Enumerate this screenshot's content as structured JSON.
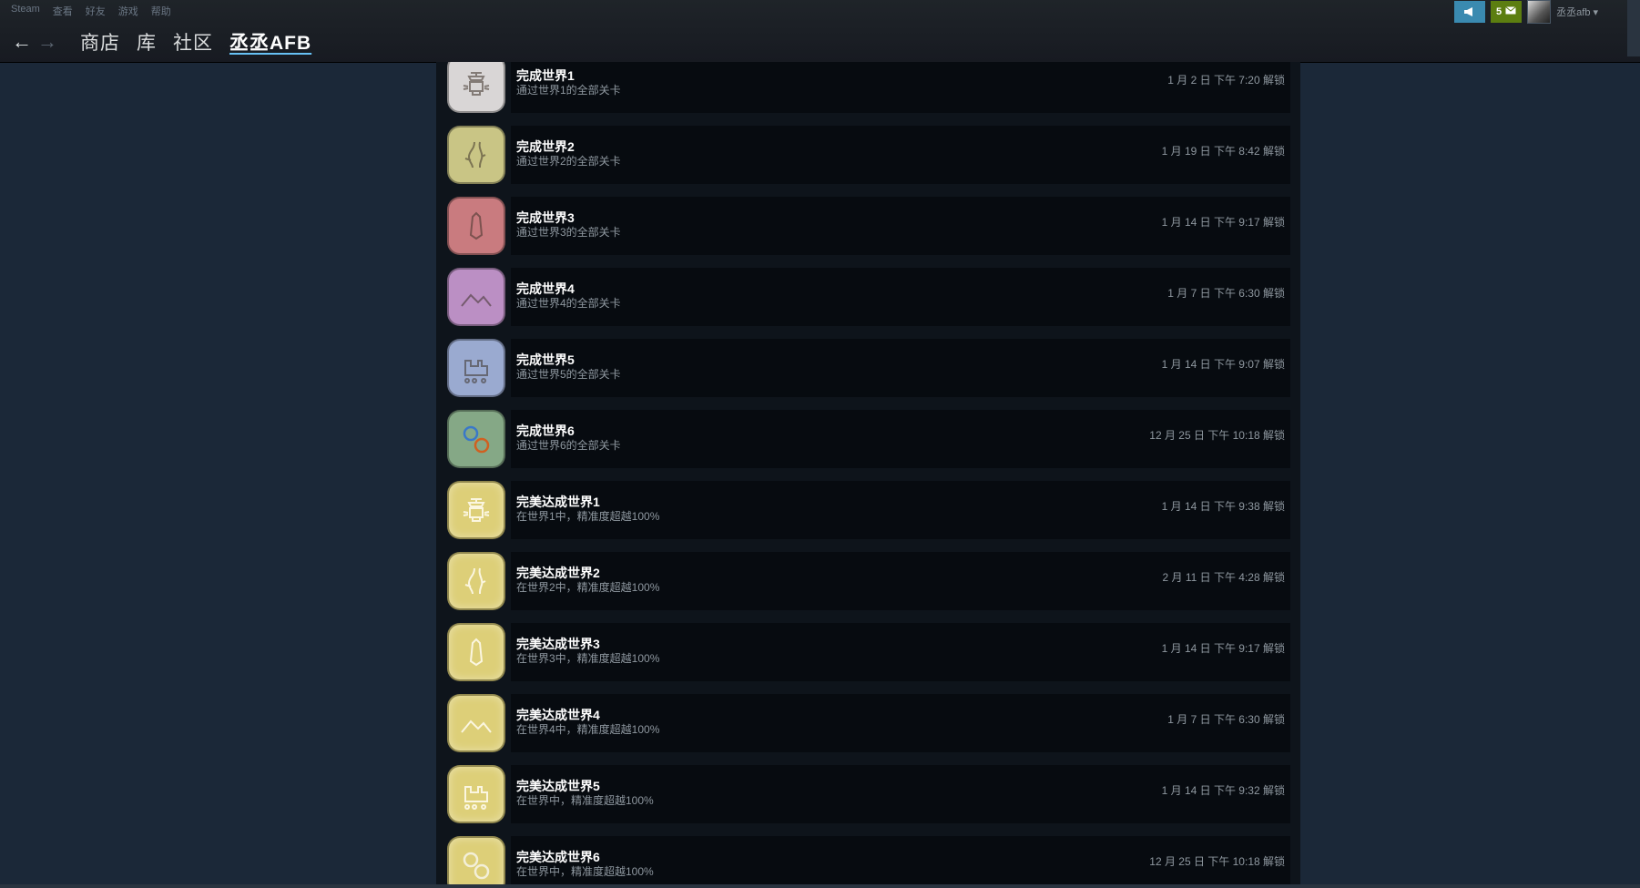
{
  "menu": [
    "Steam",
    "查看",
    "好友",
    "游戏",
    "帮助"
  ],
  "nav": {
    "back": "←",
    "forward": "→",
    "links": [
      "商店",
      "库",
      "社区"
    ],
    "active": "丞丞AFB"
  },
  "topright": {
    "notification_count": "5",
    "account_name": "丞丞afb",
    "announce_icon": "megaphone-icon",
    "mail_icon": "envelope-icon"
  },
  "colors": {
    "world1": "#d9d6d6",
    "world2": "#c9c585",
    "world3": "#c97b7f",
    "world4": "#bb8fc4",
    "world5": "#9aaad0",
    "world6": "#85a886",
    "gold": "#ddcf78"
  },
  "achievements": [
    {
      "title": "完成世界1",
      "desc": "通过世界1的全部关卡",
      "time": "1 月 2 日 下午 7:20 解锁",
      "icon": "world1-lantern-icon"
    },
    {
      "title": "完成世界2",
      "desc": "通过世界2的全部关卡",
      "time": "1 月 19 日 下午 8:42 解锁",
      "icon": "world2-forked-road-icon"
    },
    {
      "title": "完成世界3",
      "desc": "通过世界3的全部关卡",
      "time": "1 月 14 日 下午 9:17 解锁",
      "icon": "world3-crystal-icon"
    },
    {
      "title": "完成世界4",
      "desc": "通过世界4的全部关卡",
      "time": "1 月 7 日 下午 6:30 解锁",
      "icon": "world4-mountain-icon"
    },
    {
      "title": "完成世界5",
      "desc": "通过世界5的全部关卡",
      "time": "1 月 14 日 下午 9:07 解锁",
      "icon": "world5-train-icon"
    },
    {
      "title": "完成世界6",
      "desc": "通过世界6的全部关卡",
      "time": "12 月 25 日 下午 10:18 解锁",
      "icon": "world6-rings-icon"
    },
    {
      "title": "完美达成世界1",
      "desc": "在世界1中，精准度超越100%",
      "time": "1 月 14 日 下午 9:38 解锁",
      "icon": "gold-lantern-icon"
    },
    {
      "title": "完美达成世界2",
      "desc": "在世界2中，精准度超越100%",
      "time": "2 月 11 日 下午 4:28 解锁",
      "icon": "gold-forked-road-icon"
    },
    {
      "title": "完美达成世界3",
      "desc": "在世界3中，精准度超越100%",
      "time": "1 月 14 日 下午 9:17 解锁",
      "icon": "gold-crystal-icon"
    },
    {
      "title": "完美达成世界4",
      "desc": "在世界4中，精准度超越100%",
      "time": "1 月 7 日 下午 6:30 解锁",
      "icon": "gold-mountain-icon"
    },
    {
      "title": "完美达成世界5",
      "desc": "在世界中，精准度超越100%",
      "time": "1 月 14 日 下午 9:32 解锁",
      "icon": "gold-train-icon"
    },
    {
      "title": "完美达成世界6",
      "desc": "在世界中，精准度超越100%",
      "time": "12 月 25 日 下午 10:18 解锁",
      "icon": "gold-rings-icon"
    }
  ]
}
